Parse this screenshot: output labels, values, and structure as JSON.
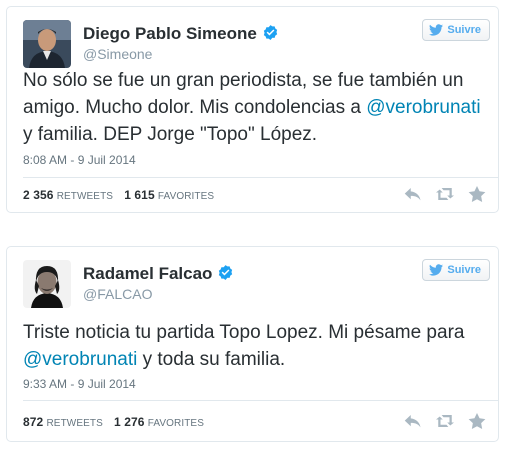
{
  "tweets": [
    {
      "name": "Diego Pablo Simeone",
      "handle": "@Simeone",
      "follow_label": "Suivre",
      "text_before": "No sólo se fue un gran periodista, se fue también un amigo. Mucho dolor. Mis condolencias a ",
      "mention": "@verobrunati",
      "text_after": " y familia. DEP Jorge \"Topo\" López.",
      "date": "8:08 AM - 9 Juil 2014",
      "retweets": "2 356",
      "retweets_label": "RETWEETS",
      "favorites": "1 615",
      "favorites_label": "FAVORITES"
    },
    {
      "name": "Radamel Falcao",
      "handle": "@FALCAO",
      "follow_label": "Suivre",
      "text_before": "Triste noticia tu partida Topo Lopez. Mi pésame para ",
      "mention": "@verobrunati",
      "text_after": " y toda su familia.",
      "date": "9:33 AM - 9 Juil 2014",
      "retweets": "872",
      "retweets_label": "RETWEETS",
      "favorites": "1 276",
      "favorites_label": "FAVORITES"
    }
  ],
  "icons": {
    "verified": "verified-badge-icon",
    "follow": "twitter-bird-icon",
    "reply": "reply-icon",
    "retweet": "retweet-icon",
    "favorite": "star-icon"
  },
  "colors": {
    "accent": "#55acee",
    "mention": "#0084b4",
    "verified": "#1da1f2",
    "action_icons": "#aab8c2"
  }
}
